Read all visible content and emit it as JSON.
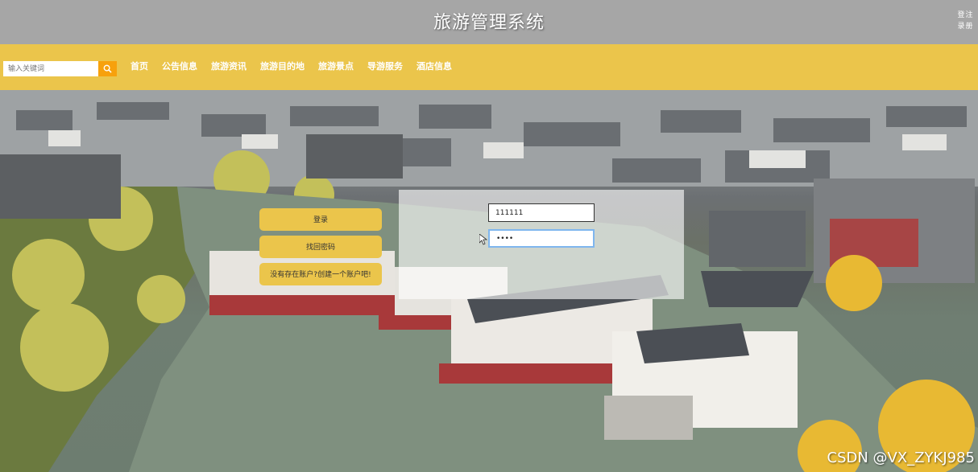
{
  "header": {
    "title": "旅游管理系统",
    "auth": {
      "line1": [
        "登",
        "注"
      ],
      "line2": [
        "录",
        "册"
      ]
    }
  },
  "nav": {
    "search_placeholder": "输入关键词",
    "search_icon": "search-icon",
    "items": [
      "首页",
      "公告信息",
      "旅游资讯",
      "旅游目的地",
      "旅游景点",
      "导游服务",
      "酒店信息"
    ]
  },
  "login": {
    "login_label": "登录",
    "forgot_label": "找回密码",
    "register_label": "没有存在账户?创建一个账户吧!",
    "username_value": "111111",
    "password_value": "••••"
  },
  "watermark": "CSDN @VX_ZYKJ985",
  "colors": {
    "header_bg": "#a6a6a6",
    "nav_bg": "#ebc54b",
    "search_button": "#f7a10c",
    "button_bg": "#ebc54b",
    "focus_border": "#7fb6ee"
  }
}
